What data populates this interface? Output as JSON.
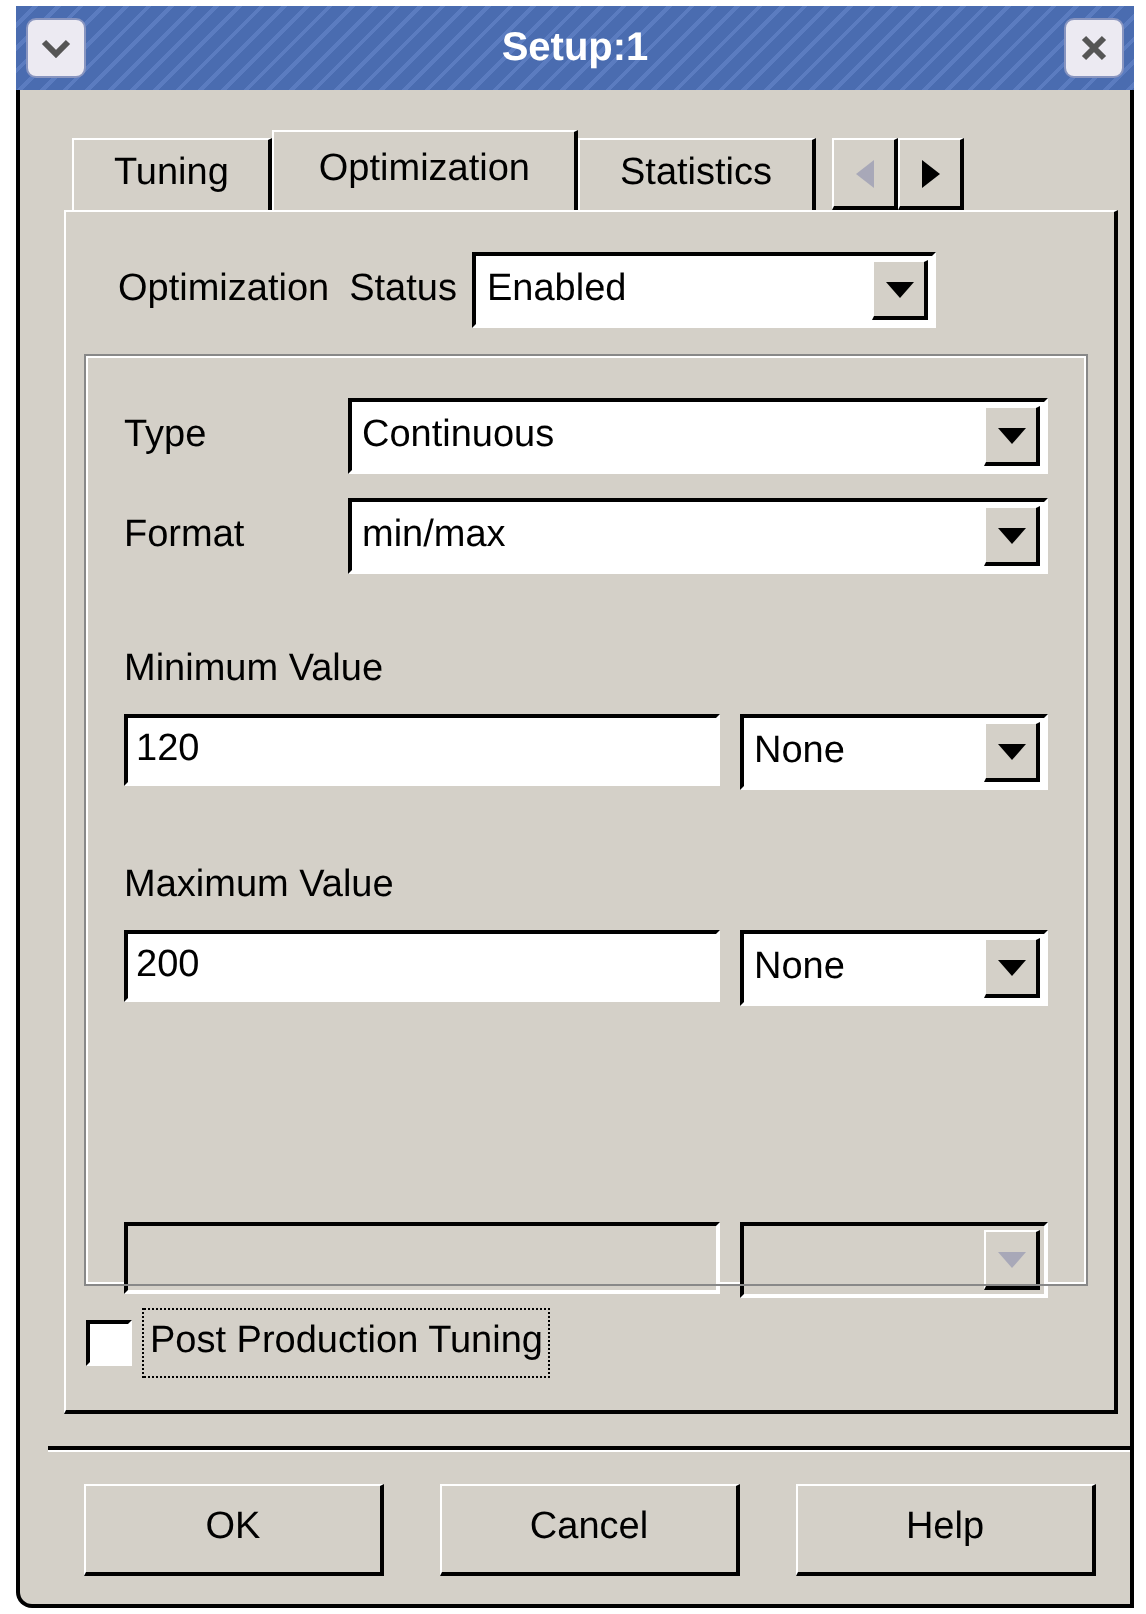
{
  "window": {
    "title": "Setup:1"
  },
  "tabs": [
    {
      "label": "Tuning",
      "selected": false
    },
    {
      "label": "Optimization",
      "selected": true
    },
    {
      "label": "Statistics",
      "selected": false
    }
  ],
  "tab_scroll": {
    "left_disabled": true,
    "right_disabled": false
  },
  "status": {
    "label": "Optimization",
    "label_2": "Status",
    "value": "Enabled"
  },
  "fields": [
    {
      "label": "Type",
      "value": "Continuous"
    },
    {
      "label": "Format",
      "value": "min/max"
    }
  ],
  "value_rows": [
    {
      "label": "Minimum Value",
      "value": "120",
      "unit": "None",
      "disabled": false
    },
    {
      "label": "Maximum Value",
      "value": "200",
      "unit": "None",
      "disabled": false
    },
    {
      "disabled": true
    }
  ],
  "checkbox": {
    "label": "Post Production Tuning",
    "checked": false,
    "focused": true
  },
  "buttons": [
    "OK",
    "Cancel",
    "Help"
  ]
}
